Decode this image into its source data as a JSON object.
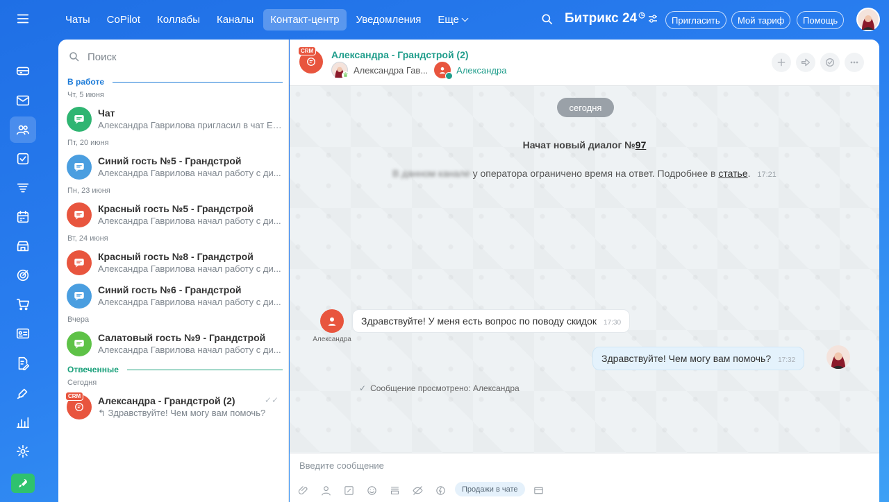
{
  "colors": {
    "accent": "#2a7ff0",
    "green": "#2fb572",
    "teal": "#1f9d8b",
    "red": "#e8553e",
    "blue": "#4a9ee0",
    "lime": "#5ec247",
    "section_blue": "#1d7bd8",
    "section_teal": "#19a07a"
  },
  "rail": {
    "icons": [
      "menu-icon",
      "feed-icon",
      "mail-icon",
      "contacts-icon",
      "tasks-icon",
      "filter-icon",
      "calendar-icon",
      "store-icon",
      "target-icon",
      "cart-icon",
      "card-icon",
      "doc-edit-icon",
      "sign-icon",
      "analytics-icon",
      "settings-icon",
      "rocket-icon"
    ]
  },
  "topbar": {
    "nav": [
      "Чаты",
      "CoPilot",
      "Коллабы",
      "Каналы",
      "Контакт-центр",
      "Уведомления",
      "Еще"
    ],
    "brand": "Битрикс",
    "brand_num": "24",
    "invite": "Пригласить",
    "tariff": "Мой тариф",
    "help": "Помощь"
  },
  "sidebar": {
    "search_placeholder": "Поиск",
    "section_work": "В работе",
    "section_answered": "Отвеченные",
    "crm_badge": "CRM",
    "dates": [
      "Чт, 5 июня",
      "Пт, 20 июня",
      "Пн, 23 июня",
      "Вт, 24 июня",
      "Вчера",
      "Сегодня"
    ],
    "chats": [
      {
        "title": "Чат",
        "subtitle": "Александра Гаврилова пригласил в чат Ел...",
        "color": "#2fb572"
      },
      {
        "title": "Синий гость №5 - Грандстрой",
        "subtitle": "Александра Гаврилова начал работу с ди...",
        "color": "#4a9ee0"
      },
      {
        "title": "Красный гость №5 - Грандстрой",
        "subtitle": "Александра Гаврилова начал работу с ди...",
        "color": "#e8553e"
      },
      {
        "title": "Красный гость №8 - Грандстрой",
        "subtitle": "Александра Гаврилова начал работу с ди...",
        "color": "#e8553e"
      },
      {
        "title": "Синий гость №6 - Грандстрой",
        "subtitle": "Александра Гаврилова начал работу с ди...",
        "color": "#4a9ee0"
      },
      {
        "title": "Салатовый гость №9 - Грандстрой",
        "subtitle": "Александра Гаврилова начал работу с ди...",
        "color": "#5ec247"
      },
      {
        "title": "Александра - Грандстрой (2)",
        "subtitle": "Здравствуйте! Чем могу вам помочь?",
        "color": "#e8553e"
      }
    ]
  },
  "header": {
    "title": "Александра - Грандстрой (2)",
    "member1": "Александра Гав...",
    "member2": "Александра"
  },
  "messages": {
    "day": "сегодня",
    "system_prefix": "Начат новый диалог №",
    "system_num": "97",
    "notice_text": "у оператора ограничено время на ответ. Подробнее в",
    "notice_link": "статье",
    "notice_time": "17:21",
    "client_name": "Александра",
    "incoming": "Здравствуйте! У меня есть вопрос по поводу скидок",
    "incoming_time": "17:30",
    "outgoing": "Здравствуйте! Чем могу вам помочь?",
    "outgoing_time": "17:32",
    "seen": "Сообщение просмотрено: Александра"
  },
  "composer": {
    "placeholder": "Введите сообщение",
    "sales": "Продажи в чате"
  }
}
